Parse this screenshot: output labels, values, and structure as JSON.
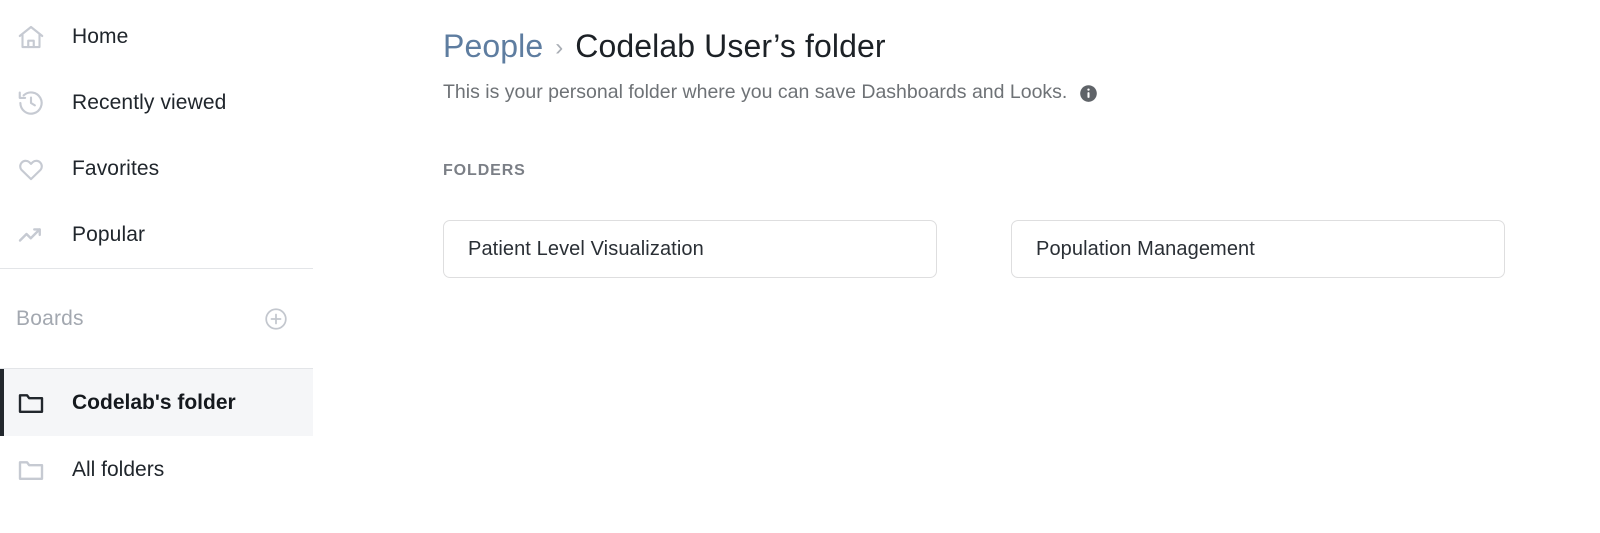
{
  "sidebar": {
    "nav_items": [
      {
        "label": "Home",
        "icon": "home-icon"
      },
      {
        "label": "Recently viewed",
        "icon": "history-clock-icon"
      },
      {
        "label": "Favorites",
        "icon": "heart-icon"
      },
      {
        "label": "Popular",
        "icon": "trending-up-icon"
      }
    ],
    "boards": {
      "title": "Boards",
      "add_icon": "plus-circle-icon"
    },
    "folders": [
      {
        "label": "Codelab's folder",
        "icon": "folder-icon",
        "active": true
      },
      {
        "label": "All folders",
        "icon": "folder-icon",
        "active": false
      }
    ]
  },
  "main": {
    "breadcrumb": {
      "parent": "People",
      "separator": "›",
      "current": "Codelab User’s folder"
    },
    "description": "This is your personal folder where you can save Dashboards and Looks.",
    "info_icon": "info-icon",
    "section_label": "FOLDERS",
    "folder_cards": [
      {
        "title": "Patient Level Visualization"
      },
      {
        "title": "Population Management"
      }
    ]
  },
  "colors": {
    "link": "#5e7da0",
    "text": "#1c2126",
    "muted": "#6e7276",
    "icon_muted": "#c6cad2",
    "active_bar": "#22272d",
    "active_bg": "#f5f6f8",
    "card_border": "#dededf",
    "divider": "#e3e5e8"
  }
}
